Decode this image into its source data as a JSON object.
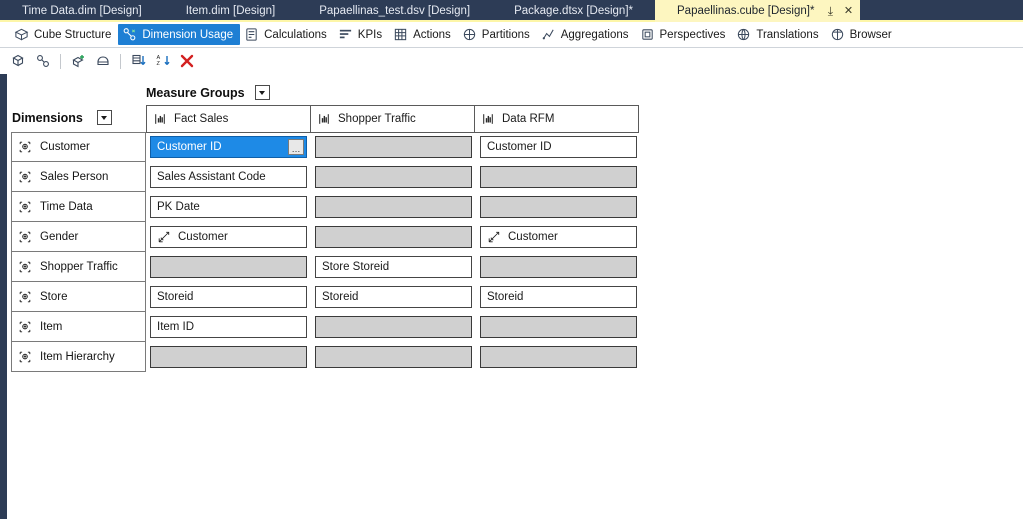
{
  "window": {
    "document_tabs": [
      {
        "label": "Time Data.dim [Design]",
        "active": false
      },
      {
        "label": "Item.dim [Design]",
        "active": false
      },
      {
        "label": "Papaellinas_test.dsv [Design]",
        "active": false
      },
      {
        "label": "Package.dtsx [Design]*",
        "active": false
      },
      {
        "label": "Papaellinas.cube [Design]*",
        "active": true
      }
    ],
    "tab_pin_label": "⤓",
    "tab_close_label": "✕",
    "active_tab_bg": "#fdf6c0",
    "chrome_bg": "#2d3c56"
  },
  "designer_tabs": [
    {
      "label": "Cube Structure",
      "icon": "cube-structure-icon",
      "active": false
    },
    {
      "label": "Dimension Usage",
      "icon": "dimension-usage-icon",
      "active": true
    },
    {
      "label": "Calculations",
      "icon": "calculations-icon",
      "active": false
    },
    {
      "label": "KPIs",
      "icon": "kpis-icon",
      "active": false
    },
    {
      "label": "Actions",
      "icon": "actions-icon",
      "active": false
    },
    {
      "label": "Partitions",
      "icon": "partitions-icon",
      "active": false
    },
    {
      "label": "Aggregations",
      "icon": "aggregations-icon",
      "active": false
    },
    {
      "label": "Perspectives",
      "icon": "perspectives-icon",
      "active": false
    },
    {
      "label": "Translations",
      "icon": "translations-icon",
      "active": false
    },
    {
      "label": "Browser",
      "icon": "browser-icon",
      "active": false
    }
  ],
  "toolbar": {
    "buttons": [
      {
        "name": "add-cube-dimension-icon",
        "tooltip": "Add Cube Dimension"
      },
      {
        "name": "edit-relationship-icon",
        "tooltip": "Edit Relationship"
      },
      {
        "name": "new-linked-object-icon",
        "tooltip": "New Linked Object"
      },
      {
        "name": "show-hide-icon",
        "tooltip": "Show/Hide"
      },
      {
        "name": "sort-ascending-icon",
        "tooltip": "Sort Ascending"
      },
      {
        "name": "sort-az-descending-icon",
        "tooltip": "Sort A-Z"
      },
      {
        "name": "delete-icon",
        "tooltip": "Delete"
      }
    ],
    "accent_delete_color": "#d32020",
    "accent_sort_color": "#1a6fbf"
  },
  "grid": {
    "measure_groups_caption": "Measure Groups",
    "dimensions_caption": "Dimensions",
    "measure_groups": [
      {
        "label": "Fact Sales",
        "icon": "measure-group-icon"
      },
      {
        "label": "Shopper Traffic",
        "icon": "measure-group-icon"
      },
      {
        "label": "Data RFM",
        "icon": "measure-group-icon"
      }
    ],
    "rows": [
      {
        "dimension": "Customer",
        "cells": [
          {
            "value": "Customer ID",
            "state": "selected",
            "icon": null,
            "has_ellipsis": true
          },
          {
            "value": "",
            "state": "empty",
            "icon": null,
            "has_ellipsis": false
          },
          {
            "value": "Customer ID",
            "state": "filled",
            "icon": null,
            "has_ellipsis": false
          }
        ]
      },
      {
        "dimension": "Sales Person",
        "cells": [
          {
            "value": "Sales Assistant Code",
            "state": "filled",
            "icon": null,
            "has_ellipsis": false
          },
          {
            "value": "",
            "state": "empty",
            "icon": null,
            "has_ellipsis": false
          },
          {
            "value": "",
            "state": "empty",
            "icon": null,
            "has_ellipsis": false
          }
        ]
      },
      {
        "dimension": "Time Data",
        "cells": [
          {
            "value": "PK Date",
            "state": "filled",
            "icon": null,
            "has_ellipsis": false
          },
          {
            "value": "",
            "state": "empty",
            "icon": null,
            "has_ellipsis": false
          },
          {
            "value": "",
            "state": "empty",
            "icon": null,
            "has_ellipsis": false
          }
        ]
      },
      {
        "dimension": "Gender",
        "cells": [
          {
            "value": "Customer",
            "state": "filled",
            "icon": "referenced-relationship-icon",
            "has_ellipsis": false
          },
          {
            "value": "",
            "state": "empty",
            "icon": null,
            "has_ellipsis": false
          },
          {
            "value": "Customer",
            "state": "filled",
            "icon": "referenced-relationship-icon",
            "has_ellipsis": false
          }
        ]
      },
      {
        "dimension": "Shopper Traffic",
        "cells": [
          {
            "value": "",
            "state": "empty",
            "icon": null,
            "has_ellipsis": false
          },
          {
            "value": "Store Storeid",
            "state": "filled",
            "icon": null,
            "has_ellipsis": false
          },
          {
            "value": "",
            "state": "empty",
            "icon": null,
            "has_ellipsis": false
          }
        ]
      },
      {
        "dimension": "Store",
        "cells": [
          {
            "value": "Storeid",
            "state": "filled",
            "icon": null,
            "has_ellipsis": false
          },
          {
            "value": "Storeid",
            "state": "filled",
            "icon": null,
            "has_ellipsis": false
          },
          {
            "value": "Storeid",
            "state": "filled",
            "icon": null,
            "has_ellipsis": false
          }
        ]
      },
      {
        "dimension": "Item",
        "cells": [
          {
            "value": "Item ID",
            "state": "filled",
            "icon": null,
            "has_ellipsis": false
          },
          {
            "value": "",
            "state": "empty",
            "icon": null,
            "has_ellipsis": false
          },
          {
            "value": "",
            "state": "empty",
            "icon": null,
            "has_ellipsis": false
          }
        ]
      },
      {
        "dimension": "Item Hierarchy",
        "cells": [
          {
            "value": "",
            "state": "empty",
            "icon": null,
            "has_ellipsis": false
          },
          {
            "value": "",
            "state": "empty",
            "icon": null,
            "has_ellipsis": false
          },
          {
            "value": "",
            "state": "empty",
            "icon": null,
            "has_ellipsis": false
          }
        ]
      }
    ],
    "ellipsis_label": "…",
    "selection_color": "#1e8ae6"
  }
}
